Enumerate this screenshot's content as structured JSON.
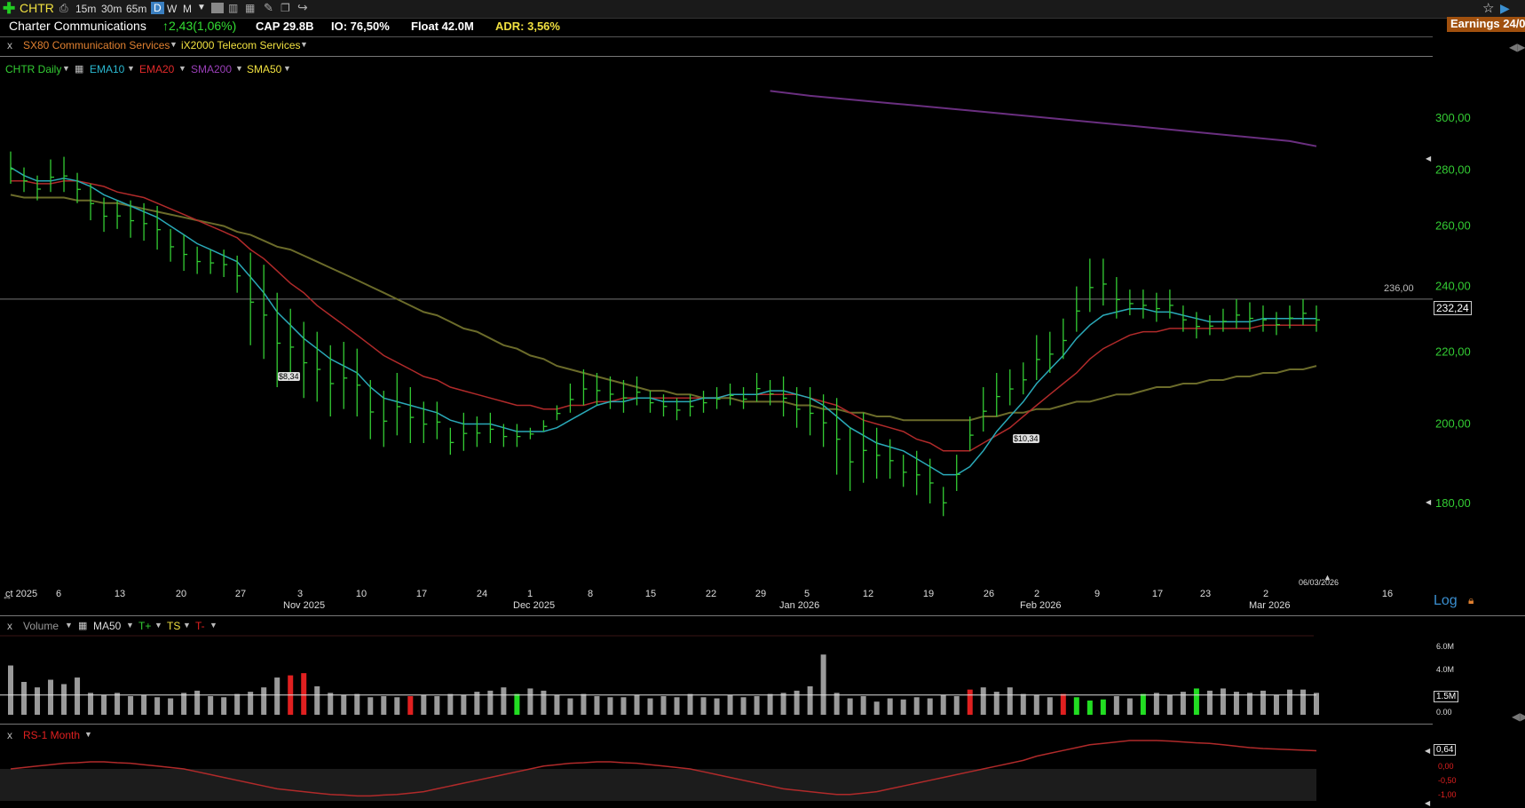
{
  "toolbar": {
    "symbol": "CHTR",
    "timeframes": [
      "15m",
      "30m",
      "65m",
      "D",
      "W",
      "M"
    ],
    "active_timeframe": "D",
    "earnings": "Earnings 24/0"
  },
  "header": {
    "company": "Charter Communications",
    "change": "↑2,43(1,06%)",
    "cap": "CAP 29.8B",
    "io": "IO: 76,50%",
    "float": "Float 42.0M",
    "adr": "ADR: 3,56%",
    "sector": "SX80 Communication Services",
    "industry": "iX2000 Telecom Services"
  },
  "colors": {
    "up": "#33cc33",
    "ema10": "#2aa9b8",
    "ema20": "#b02a2a",
    "sma200": "#6a2f80",
    "sma50": "#6b6b2a",
    "volume_up": "#22dd22",
    "volume_down": "#e02020",
    "volume_neutral": "#9a9a9a",
    "accent_yellow": "#f0e040"
  },
  "price_pane": {
    "legend": {
      "title": "CHTR Daily",
      "ema10": "EMA10",
      "ema20": "EMA20",
      "sma200": "SMA200",
      "sma50": "SMA50"
    },
    "y_axis_labels": [
      "300,00",
      "280,00",
      "260,00",
      "240,00",
      "220,00",
      "200,00",
      "180,00"
    ],
    "horizontal_line_label": "236,00",
    "last_price_label": "232,24",
    "annotation_low1": "$8,34",
    "annotation_low2": "$10,34",
    "scale_mode": "Log"
  },
  "x_axis": {
    "day_ticks": [
      "ct 2025",
      "6",
      "13",
      "20",
      "27",
      "3",
      "10",
      "17",
      "24",
      "1",
      "8",
      "15",
      "22",
      "29",
      "5",
      "12",
      "19",
      "26",
      "2",
      "9",
      "17",
      "23",
      "2",
      "16"
    ],
    "month_labels": [
      "Nov 2025",
      "Dec 2025",
      "Jan 2026",
      "Feb 2026",
      "Mar 2026"
    ],
    "current_date": "06/03/2026"
  },
  "volume_pane": {
    "close_x": "x",
    "title": "Volume",
    "ma": "MA50",
    "t_plus": "T+",
    "ts": "TS",
    "t_minus": "T-",
    "y_axis_labels": [
      "6.0M",
      "4.0M",
      "0.00"
    ],
    "current_label": "1.5M"
  },
  "rs_pane": {
    "close_x": "x",
    "title": "RS-1 Month",
    "current_label": "0,64",
    "y_axis_labels": [
      "0,00",
      "-0,50",
      "-1,00"
    ]
  },
  "chart_data": {
    "type": "candlestick",
    "title": "CHTR Daily",
    "ylim": [
      175,
      315
    ],
    "y_scale": "log",
    "horizontal_line": 236,
    "last_price": 232.24,
    "ohlc_highs": [
      287,
      281,
      278,
      284,
      285,
      279,
      275,
      270,
      269,
      269,
      268,
      267,
      259,
      257,
      253,
      252,
      252,
      250,
      251,
      247,
      238,
      233,
      229,
      226,
      222,
      223,
      221,
      212,
      209,
      214,
      210,
      206,
      206,
      199,
      203,
      202,
      203,
      200,
      200,
      199,
      201,
      205,
      211,
      215,
      214,
      213,
      212,
      213,
      209,
      208,
      207,
      208,
      209,
      210,
      211,
      210,
      214,
      212,
      213,
      210,
      210,
      208,
      207,
      199,
      203,
      199,
      196,
      192,
      193,
      191,
      184,
      192,
      202,
      210,
      214,
      215,
      217,
      225,
      226,
      230,
      240,
      249,
      249,
      243,
      239,
      239,
      238,
      239,
      234,
      232,
      231,
      233,
      236,
      235,
      234,
      232,
      234,
      236,
      234
    ],
    "ohlc_lows": [
      275,
      272,
      269,
      272,
      272,
      268,
      262,
      258,
      259,
      256,
      255,
      252,
      248,
      245,
      244,
      244,
      243,
      238,
      222,
      218,
      210,
      212,
      207,
      206,
      202,
      204,
      202,
      196,
      194,
      197,
      195,
      195,
      196,
      192,
      193,
      194,
      195,
      194,
      194,
      196,
      198,
      201,
      203,
      205,
      205,
      204,
      203,
      205,
      203,
      202,
      201,
      202,
      203,
      204,
      205,
      204,
      206,
      205,
      202,
      199,
      197,
      194,
      187,
      183,
      185,
      186,
      186,
      184,
      182,
      180,
      177,
      183,
      193,
      198,
      202,
      205,
      208,
      212,
      214,
      218,
      226,
      232,
      234,
      230,
      231,
      230,
      229,
      230,
      226,
      224,
      225,
      226,
      227,
      226,
      226,
      225,
      227,
      228,
      226
    ],
    "ema10": [
      281,
      278,
      276,
      276,
      277,
      276,
      274,
      271,
      269,
      267,
      265,
      263,
      260,
      257,
      254,
      252,
      250,
      248,
      243,
      238,
      232,
      228,
      224,
      221,
      218,
      216,
      214,
      210,
      207,
      206,
      205,
      204,
      203,
      201,
      200,
      200,
      200,
      199,
      198,
      198,
      198,
      199,
      201,
      203,
      205,
      206,
      206,
      207,
      207,
      206,
      206,
      206,
      207,
      207,
      208,
      208,
      208,
      209,
      209,
      208,
      207,
      205,
      202,
      199,
      197,
      195,
      194,
      193,
      191,
      189,
      187,
      187,
      189,
      193,
      198,
      202,
      206,
      211,
      215,
      219,
      224,
      228,
      231,
      232,
      233,
      233,
      232,
      232,
      231,
      230,
      229,
      229,
      229,
      229,
      230,
      230,
      230,
      230,
      230
    ],
    "ema20": [
      276,
      276,
      275,
      275,
      276,
      276,
      275,
      274,
      272,
      271,
      270,
      268,
      266,
      264,
      262,
      260,
      258,
      256,
      252,
      249,
      245,
      241,
      238,
      234,
      231,
      228,
      225,
      222,
      219,
      217,
      215,
      213,
      212,
      210,
      209,
      208,
      207,
      206,
      205,
      205,
      204,
      204,
      205,
      205,
      206,
      206,
      207,
      207,
      207,
      207,
      207,
      207,
      207,
      207,
      208,
      208,
      208,
      208,
      208,
      208,
      207,
      206,
      205,
      203,
      201,
      200,
      199,
      198,
      196,
      195,
      193,
      193,
      193,
      195,
      197,
      199,
      202,
      205,
      208,
      211,
      214,
      218,
      221,
      223,
      225,
      226,
      226,
      227,
      227,
      227,
      227,
      227,
      227,
      227,
      228,
      228,
      228,
      228,
      228
    ],
    "sma50": [
      271,
      270,
      270,
      270,
      270,
      269,
      269,
      268,
      268,
      267,
      266,
      265,
      264,
      263,
      262,
      261,
      260,
      258,
      257,
      255,
      253,
      252,
      250,
      248,
      246,
      244,
      242,
      240,
      238,
      236,
      234,
      232,
      231,
      229,
      227,
      226,
      224,
      222,
      221,
      219,
      218,
      216,
      215,
      214,
      213,
      212,
      211,
      210,
      209,
      209,
      208,
      208,
      207,
      207,
      207,
      206,
      206,
      206,
      206,
      205,
      205,
      204,
      204,
      203,
      203,
      202,
      202,
      201,
      201,
      201,
      201,
      201,
      201,
      202,
      202,
      203,
      203,
      204,
      204,
      205,
      206,
      206,
      207,
      208,
      208,
      209,
      210,
      210,
      211,
      211,
      212,
      212,
      213,
      213,
      214,
      214,
      215,
      215,
      216
    ],
    "sma200_points": [
      [
        57,
        311
      ],
      [
        60,
        309
      ],
      [
        66,
        306
      ],
      [
        72,
        303
      ],
      [
        78,
        300
      ],
      [
        84,
        297
      ],
      [
        90,
        294
      ],
      [
        96,
        291
      ],
      [
        98,
        289
      ]
    ],
    "volume_millions": [
      4.5,
      3.0,
      2.5,
      3.2,
      2.8,
      3.4,
      2.0,
      1.8,
      2.0,
      1.7,
      1.8,
      1.6,
      1.5,
      2.0,
      2.2,
      1.7,
      1.6,
      1.9,
      2.1,
      2.5,
      3.4,
      3.6,
      3.8,
      2.6,
      2.0,
      1.8,
      1.9,
      1.6,
      1.7,
      1.6,
      1.7,
      1.8,
      1.7,
      1.9,
      1.8,
      2.1,
      2.2,
      2.5,
      1.9,
      2.4,
      2.2,
      1.8,
      1.5,
      1.9,
      1.7,
      1.6,
      1.6,
      1.8,
      1.5,
      1.7,
      1.6,
      1.9,
      1.6,
      1.5,
      1.8,
      1.6,
      1.7,
      1.9,
      2.0,
      2.2,
      2.6,
      5.5,
      2.0,
      1.5,
      1.7,
      1.2,
      1.5,
      1.4,
      1.6,
      1.5,
      1.8,
      1.7,
      2.3,
      2.5,
      2.1,
      2.5,
      1.9,
      1.8,
      1.6,
      1.9,
      1.6,
      1.3,
      1.4,
      1.7,
      1.5,
      1.9,
      2.0,
      1.8,
      2.1,
      2.4,
      2.2,
      2.4,
      2.1,
      2.0,
      2.2,
      1.8,
      2.3,
      2.3,
      2.0
    ],
    "volume_colors": [
      "n",
      "n",
      "n",
      "n",
      "n",
      "n",
      "n",
      "n",
      "n",
      "n",
      "n",
      "n",
      "n",
      "n",
      "n",
      "n",
      "n",
      "n",
      "n",
      "n",
      "n",
      "d",
      "d",
      "n",
      "n",
      "n",
      "n",
      "n",
      "n",
      "n",
      "d",
      "n",
      "n",
      "n",
      "n",
      "n",
      "n",
      "n",
      "u",
      "n",
      "n",
      "n",
      "n",
      "n",
      "n",
      "n",
      "n",
      "n",
      "n",
      "n",
      "n",
      "n",
      "n",
      "n",
      "n",
      "n",
      "n",
      "n",
      "n",
      "n",
      "n",
      "n",
      "n",
      "n",
      "n",
      "n",
      "n",
      "n",
      "n",
      "n",
      "n",
      "n",
      "d",
      "n",
      "n",
      "n",
      "n",
      "n",
      "n",
      "d",
      "u",
      "u",
      "u",
      "n",
      "n",
      "u",
      "n",
      "n",
      "n",
      "u",
      "n",
      "n",
      "n",
      "n",
      "n",
      "n",
      "n",
      "n",
      "n"
    ],
    "volume_ma50": 1.8,
    "rs_1_month": [
      0.0,
      0.05,
      0.1,
      0.15,
      0.2,
      0.22,
      0.25,
      0.25,
      0.22,
      0.2,
      0.15,
      0.1,
      0.05,
      0.0,
      -0.1,
      -0.2,
      -0.3,
      -0.4,
      -0.5,
      -0.6,
      -0.7,
      -0.75,
      -0.8,
      -0.85,
      -0.9,
      -0.92,
      -0.95,
      -0.95,
      -0.92,
      -0.9,
      -0.85,
      -0.8,
      -0.7,
      -0.6,
      -0.5,
      -0.4,
      -0.3,
      -0.2,
      -0.1,
      0.0,
      0.1,
      0.15,
      0.2,
      0.22,
      0.25,
      0.25,
      0.22,
      0.2,
      0.15,
      0.1,
      0.05,
      0.0,
      -0.1,
      -0.2,
      -0.3,
      -0.4,
      -0.5,
      -0.6,
      -0.7,
      -0.75,
      -0.8,
      -0.85,
      -0.9,
      -0.9,
      -0.85,
      -0.8,
      -0.7,
      -0.6,
      -0.5,
      -0.4,
      -0.3,
      -0.2,
      -0.1,
      0.0,
      0.1,
      0.2,
      0.3,
      0.45,
      0.55,
      0.65,
      0.75,
      0.85,
      0.9,
      0.95,
      1.0,
      1.0,
      1.0,
      0.98,
      0.95,
      0.92,
      0.9,
      0.85,
      0.8,
      0.75,
      0.72,
      0.7,
      0.68,
      0.66,
      0.64
    ]
  }
}
